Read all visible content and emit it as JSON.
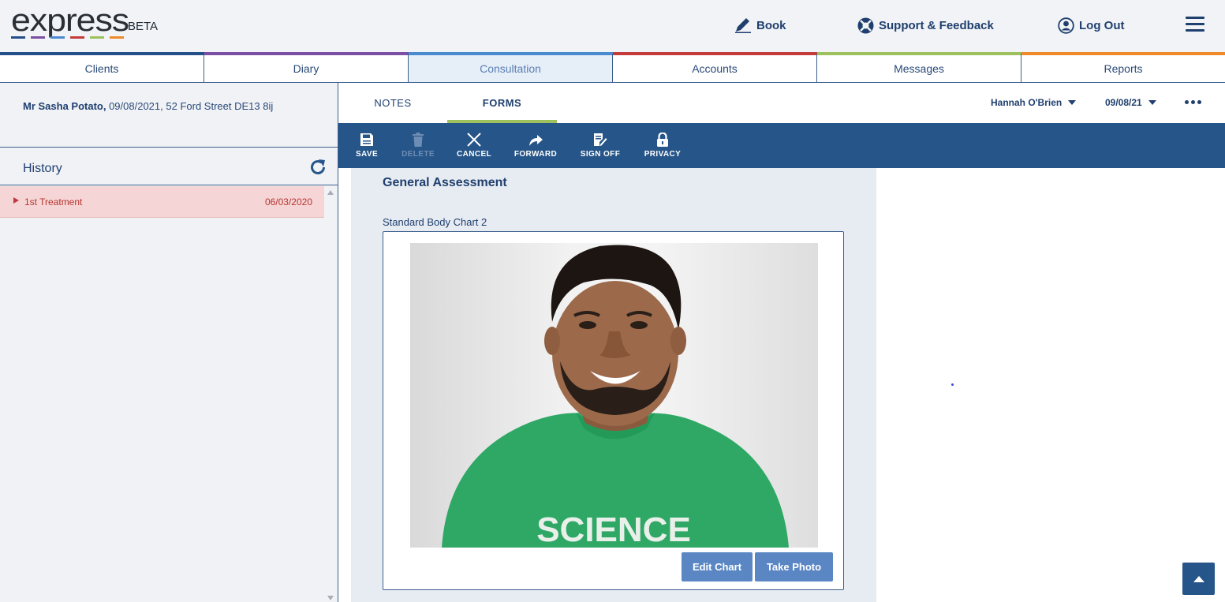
{
  "app": {
    "logo_text": "express",
    "beta_label": "BETA",
    "stripe_colors": [
      "#24508a",
      "#7b4fa3",
      "#4a8bd0",
      "#c43b3b",
      "#9cc15d",
      "#ef8a2b"
    ]
  },
  "header": {
    "book_label": "Book",
    "support_label": "Support & Feedback",
    "logout_label": "Log Out"
  },
  "tabs": [
    {
      "label": "Clients",
      "color": "#24508a"
    },
    {
      "label": "Diary",
      "color": "#7b4fa3"
    },
    {
      "label": "Consultation",
      "color": "#4a8bd0",
      "active": true
    },
    {
      "label": "Accounts",
      "color": "#c43b3b"
    },
    {
      "label": "Messages",
      "color": "#9cc15d"
    },
    {
      "label": "Reports",
      "color": "#ef8a2b"
    }
  ],
  "client": {
    "name": "Mr Sasha Potato,",
    "details": " 09/08/2021, 52 Ford Street DE13 8ij"
  },
  "history": {
    "title": "History",
    "items": [
      {
        "label": "1st Treatment",
        "date": "06/03/2020"
      }
    ]
  },
  "subnav": {
    "notes_label": "NOTES",
    "forms_label": "FORMS",
    "practitioner": "Hannah O'Brien",
    "date": "09/08/21"
  },
  "toolbar": {
    "save": "SAVE",
    "delete": "DELETE",
    "cancel": "CANCEL",
    "forward": "FORWARD",
    "sign_off": "SIGN OFF",
    "privacy": "PRIVACY"
  },
  "form": {
    "title": "General Assessment",
    "chart_label": "Standard Body Chart 2",
    "photo_shirt_text": "SCIENCE",
    "edit_chart_label": "Edit Chart",
    "take_photo_label": "Take Photo"
  }
}
